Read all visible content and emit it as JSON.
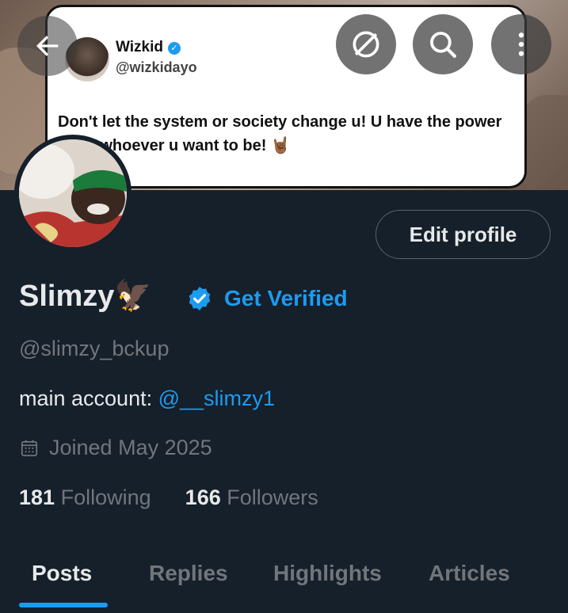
{
  "banner": {
    "tweet": {
      "name": "Wizkid",
      "handle": "@wizkidayo",
      "text": "Don't let the system or society change u! U have the power to be whoever u want to be! 🤘🏾"
    }
  },
  "nav": {
    "back_icon": "arrow-left-icon",
    "grok_icon": "grok-icon",
    "search_icon": "search-icon",
    "more_icon": "more-vertical-icon"
  },
  "profile": {
    "display_name": "Slimzy🦅",
    "get_verified": "Get Verified",
    "handle": "@slimzy_bckup",
    "bio_prefix": "main account: ",
    "bio_link": "@__slimzy1",
    "joined": "Joined May 2025",
    "following_count": "181",
    "following_label": "Following",
    "followers_count": "166",
    "followers_label": "Followers",
    "edit_profile": "Edit profile"
  },
  "tabs": [
    {
      "label": "Posts",
      "active": true
    },
    {
      "label": "Replies",
      "active": false
    },
    {
      "label": "Highlights",
      "active": false
    },
    {
      "label": "Articles",
      "active": false
    }
  ],
  "colors": {
    "background": "#15202b",
    "accent": "#1d9bf0",
    "secondary_text": "#71767b",
    "primary_text": "#e7e9ea"
  }
}
